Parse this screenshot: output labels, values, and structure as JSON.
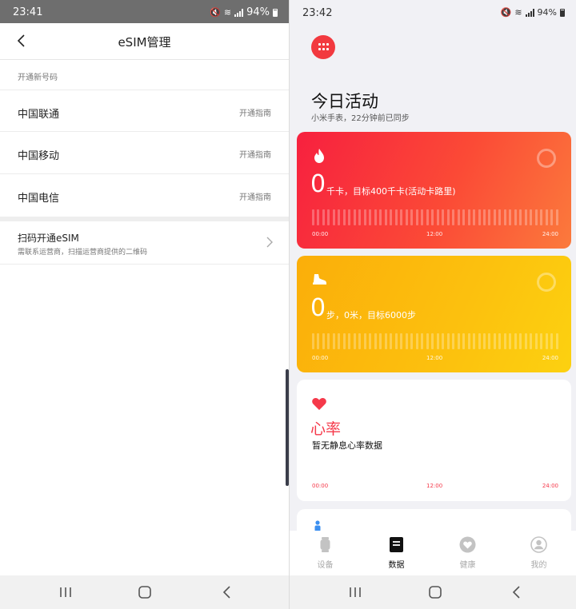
{
  "left_screen": {
    "status_bar": {
      "time": "23:41",
      "battery": "94%"
    },
    "title": "eSIM管理",
    "section_label": "开通新号码",
    "carriers": [
      {
        "name": "中国联通",
        "link": "开通指南"
      },
      {
        "name": "中国移动",
        "link": "开通指南"
      },
      {
        "name": "中国电信",
        "link": "开通指南"
      }
    ],
    "scan": {
      "title": "扫码开通eSIM",
      "subtitle": "需联系运营商，扫描运营商提供的二维码"
    }
  },
  "right_screen": {
    "status_bar": {
      "time": "23:42",
      "battery": "94%"
    },
    "heading": "今日活动",
    "subheading": "小米手表，22分钟前已同步",
    "calories_card": {
      "value": "0",
      "goal_text": "千卡，目标400千卡(活动卡路里)",
      "ticks": [
        "00:00",
        "12:00",
        "24:00"
      ],
      "colors": [
        "#f7203f",
        "#fb7a3c"
      ]
    },
    "steps_card": {
      "value": "0",
      "goal_text": "步，0米，目标6000步",
      "ticks": [
        "00:00",
        "12:00",
        "24:00"
      ],
      "colors": [
        "#fbae0a",
        "#fcd110"
      ]
    },
    "heart_card": {
      "title": "心率",
      "note": "暂无静息心率数据",
      "ticks": [
        "00:00",
        "12:00",
        "24:00"
      ],
      "accent": "#f5394a"
    },
    "tabs": [
      {
        "label": "设备",
        "icon": "watch-icon",
        "active": false
      },
      {
        "label": "数据",
        "icon": "data-icon",
        "active": true
      },
      {
        "label": "健康",
        "icon": "health-icon",
        "active": false
      },
      {
        "label": "我的",
        "icon": "profile-icon",
        "active": false
      }
    ]
  }
}
